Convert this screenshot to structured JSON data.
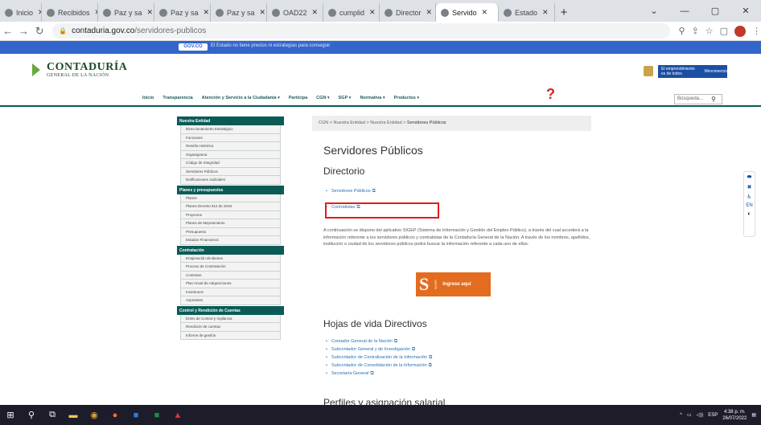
{
  "browser": {
    "tabs": [
      {
        "label": "Inicio"
      },
      {
        "label": "Recibidos"
      },
      {
        "label": "Paz y sa"
      },
      {
        "label": "Paz y sa"
      },
      {
        "label": "Paz y sa"
      },
      {
        "label": "OAD22"
      },
      {
        "label": "cumplid"
      },
      {
        "label": "Director"
      },
      {
        "label": "Servido"
      },
      {
        "label": "Estado"
      }
    ],
    "active_tab_index": 8,
    "url_host": "contaduria.gov.co",
    "url_path": "/servidores-publicos"
  },
  "govbar": {
    "logo": "GOV.CO",
    "text": "El Estado no tiene precios ni estrategias para conseguir"
  },
  "header": {
    "logo_title": "CONTADURÍA",
    "logo_subtitle": "GENERAL DE LA NACIÓN",
    "badge_text_1": "El emprendimiento es de todos",
    "badge_text_2": "Mincomercio"
  },
  "nav": {
    "items": [
      "Inicio",
      "Transparencia",
      "Atención y Servicio a la Ciudadanía ▾",
      "Participa",
      "CGN ▾",
      "SGP ▾",
      "Normativa ▾",
      "Productos ▾"
    ],
    "question_mark": "?",
    "search_placeholder": "Búsqueda...",
    "search_icon": "search-icon"
  },
  "sidebar": {
    "sections": [
      {
        "title": "Nuestra Entidad",
        "items": [
          "Direccionamiento Estratégico",
          "Funciones",
          "Reseña Histórica",
          "Organigrama",
          "Código de Integridad",
          "Servidores Públicos",
          "Notificaciones Judiciales"
        ]
      },
      {
        "title": "Planes y presupuestos",
        "items": [
          "Planes",
          "Planes Decreto 612 de 2018",
          "Proyectos",
          "Planes de Mejoramiento",
          "Presupuesto",
          "Estados Financieros"
        ]
      },
      {
        "title": "Contratación",
        "items": [
          "Enajenación de Bienes",
          "Proceso de Contratación",
          "Contratos",
          "Plan Anual de Adquisiciones",
          "Invertiones",
          "Aspirantes"
        ]
      },
      {
        "title": "Control y Rendición de Cuentas",
        "items": [
          "Entes de Control y Vigilancia",
          "Rendición de cuentas",
          "Informe de gestión"
        ]
      }
    ]
  },
  "breadcrumb": {
    "path": "CGN > Nuestra Entidad > Nuestra Entidad > ",
    "current": "Servidores Públicos"
  },
  "content": {
    "title": "Servidores Públicos",
    "directorio_heading": "Directorio",
    "directorio_links": [
      "Servidores Públicos",
      "Contratistas"
    ],
    "directorio_links_hidden": "Contratistas",
    "paragraph": "A continuación se dispone del aplicativo SIGEP (Sistema de Información y Gestión del Empleo Público), a través del cual accederá a la información referente a los servidores públicos y contratistas de la Contaduría General de la Nación. A través de los nombres, apellidos, institución o ciudad de los servidores públicos podrá buscar la información referente a cada uno de ellos.",
    "sigep_logo": "S",
    "sigep_tag": "SIGEP",
    "sigep_button": "Ingrese aquí",
    "hojas_heading": "Hojas de vida Directivos",
    "hojas_links": [
      "Contador General de la Nación",
      "Subcontador General y de Investigación",
      "Subcontador de Centralización de la Información",
      "Subcontador de Consolidación de la Información",
      "Secretaría General"
    ],
    "next_heading": "Perfiles y asignación salarial"
  },
  "a11y": {
    "lang": "EN"
  },
  "taskbar": {
    "time": "4:38 p. m.",
    "date": "26/07/2022",
    "lang": "ESP"
  }
}
